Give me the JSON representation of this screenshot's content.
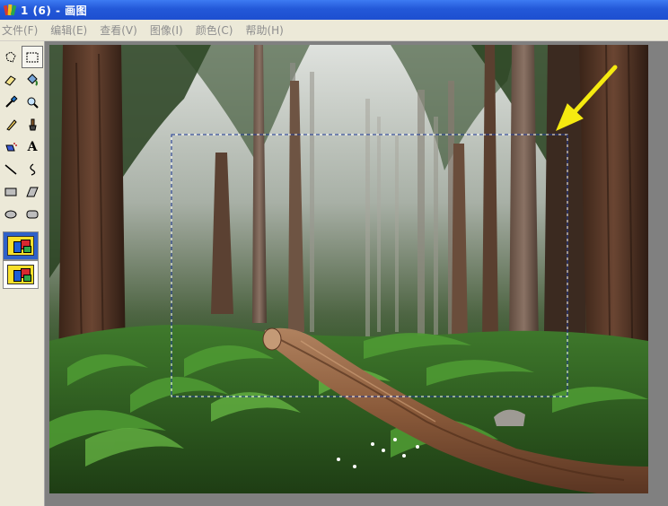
{
  "window": {
    "title": "1 (6) - 画图"
  },
  "menu": {
    "items": [
      {
        "label": "文件(F)"
      },
      {
        "label": "编辑(E)"
      },
      {
        "label": "查看(V)"
      },
      {
        "label": "图像(I)"
      },
      {
        "label": "颜色(C)"
      },
      {
        "label": "帮助(H)"
      }
    ]
  },
  "toolbox": {
    "tools": [
      {
        "name": "free-select-icon"
      },
      {
        "name": "rect-select-icon",
        "selected": true
      },
      {
        "name": "eraser-icon"
      },
      {
        "name": "fill-bucket-icon"
      },
      {
        "name": "color-picker-icon"
      },
      {
        "name": "magnifier-icon"
      },
      {
        "name": "pencil-icon"
      },
      {
        "name": "brush-icon"
      },
      {
        "name": "airbrush-icon"
      },
      {
        "name": "text-icon",
        "glyph": "A"
      },
      {
        "name": "line-icon"
      },
      {
        "name": "curve-icon"
      },
      {
        "name": "rectangle-icon"
      },
      {
        "name": "polygon-icon"
      },
      {
        "name": "ellipse-icon"
      },
      {
        "name": "rounded-rect-icon"
      }
    ],
    "options": [
      {
        "name": "opaque-selection-option",
        "selected": true
      },
      {
        "name": "transparent-selection-option",
        "selected": false
      }
    ]
  },
  "canvas": {
    "image": "redwood-forest-photo",
    "selection": "dashed-rectangle",
    "annotation": "yellow-arrow",
    "colors": {
      "arrow": "#f5ea10",
      "selection": "#1f3a9a"
    }
  }
}
